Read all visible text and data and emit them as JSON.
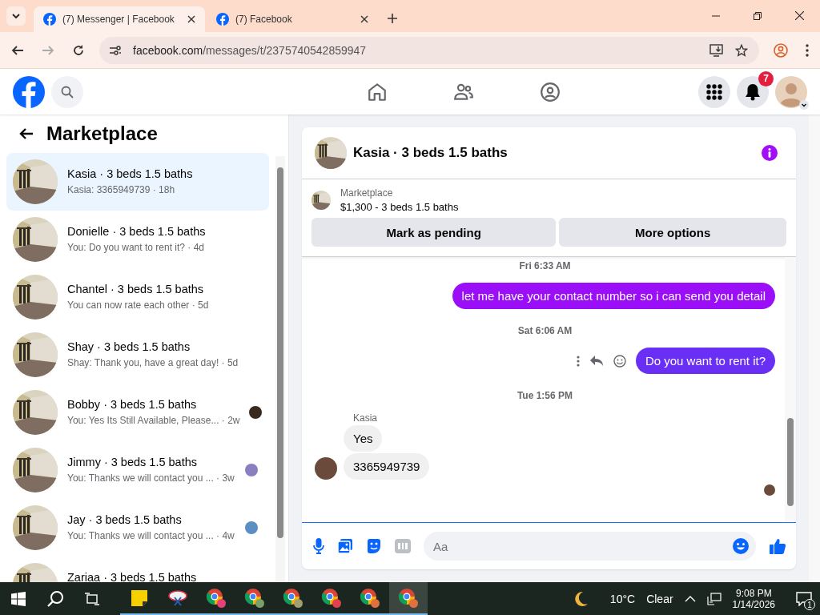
{
  "browser": {
    "tabs": [
      {
        "title": "(7) Messenger | Facebook",
        "selected": true
      },
      {
        "title": "(7) Facebook",
        "selected": false
      }
    ],
    "url_host": "facebook.com",
    "url_path": "/messages/t/2375740542859947"
  },
  "fb_nav": {
    "notification_badge": "7"
  },
  "sidebar": {
    "title": "Marketplace",
    "conversations": [
      {
        "name": "Kasia · 3 beds 1.5 baths",
        "preview": "Kasia: 3365949739 · 18h",
        "selected": true,
        "read_receipt": false
      },
      {
        "name": "Donielle · 3 beds 1.5 baths",
        "preview": "You: Do you want to rent it? · 4d",
        "selected": false,
        "read_receipt": false
      },
      {
        "name": "Chantel · 3 beds 1.5 baths",
        "preview": "You can now rate each other · 5d",
        "selected": false,
        "read_receipt": false
      },
      {
        "name": "Shay · 3 beds 1.5 baths",
        "preview": "Shay: Thank you, have a great day! · 5d",
        "selected": false,
        "read_receipt": false
      },
      {
        "name": "Bobby · 3 beds 1.5 baths",
        "preview": "You: Yes Its Still Available, Please... · 2w",
        "selected": false,
        "read_receipt": true,
        "color": "#3a2a1e"
      },
      {
        "name": "Jimmy · 3 beds 1.5 baths",
        "preview": "You: Thanks we will contact you ... · 3w",
        "selected": false,
        "read_receipt": true,
        "color": "#8a7fc0"
      },
      {
        "name": "Jay · 3 beds 1.5 baths",
        "preview": "You: Thanks we will contact you ... · 4w",
        "selected": false,
        "read_receipt": true,
        "color": "#5b8fc4"
      },
      {
        "name": "Zariaa · 3 beds 1.5 baths",
        "selected": false,
        "read_receipt": false
      }
    ]
  },
  "chat": {
    "title": "Kasia · 3 beds 1.5 baths",
    "listing_label": "Marketplace",
    "listing_title": "$1,300 - 3 beds 1.5 baths",
    "buttons": [
      "Mark as pending",
      "More options"
    ],
    "messages": [
      {
        "kind": "timestamp",
        "text": "Fri 6:33 AM"
      },
      {
        "kind": "outgoing",
        "text": "let me have your contact number so i can send you detail",
        "color": "#9b0ff8",
        "show_actions": false
      },
      {
        "kind": "timestamp",
        "text": "Sat 6:06 AM"
      },
      {
        "kind": "outgoing",
        "text": "Do you want to rent it?",
        "color": "#6a2ff5",
        "show_actions": true
      },
      {
        "kind": "timestamp",
        "text": "Tue 1:56 PM"
      },
      {
        "kind": "incoming",
        "sender": "Kasia",
        "texts": [
          "Yes",
          "3365949739"
        ]
      }
    ],
    "composer_placeholder": "Aa"
  },
  "taskbar": {
    "apps": [
      {
        "kind": "sticky",
        "selected": false
      },
      {
        "kind": "snip",
        "selected": false
      },
      {
        "kind": "chrome",
        "color": "#e8407a",
        "selected": false
      },
      {
        "kind": "chrome",
        "color": "#7aa06a",
        "selected": false
      },
      {
        "kind": "chrome",
        "color": "#a0a070",
        "selected": false
      },
      {
        "kind": "chrome",
        "color": "#e04050",
        "selected": false
      },
      {
        "kind": "chrome",
        "color": "#e07040",
        "selected": false
      },
      {
        "kind": "chrome",
        "color": "#e07040",
        "selected": true
      }
    ],
    "temperature": "10°C",
    "weather": "Clear",
    "time": "9:08 PM",
    "date": "1/14/2026",
    "notification_count": "1"
  }
}
